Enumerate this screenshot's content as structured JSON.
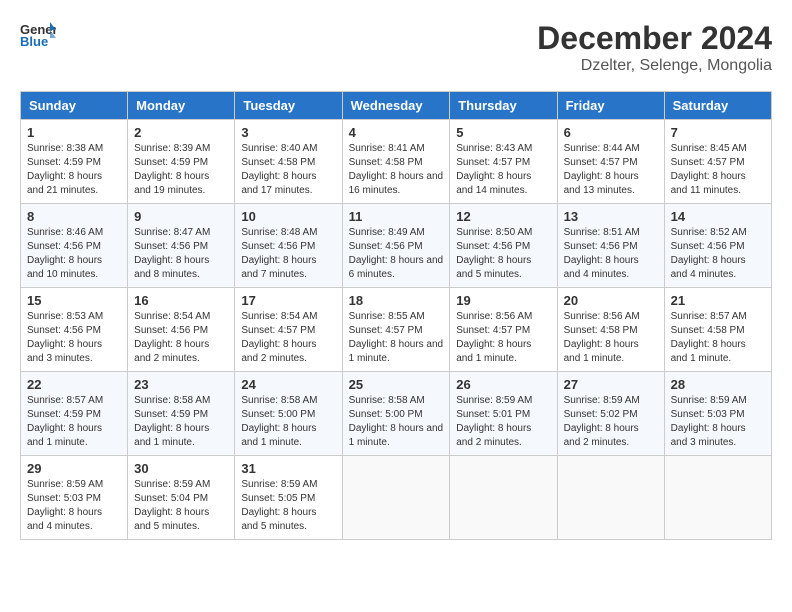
{
  "header": {
    "logo_line1": "General",
    "logo_line2": "Blue",
    "month_title": "December 2024",
    "subtitle": "Dzelter, Selenge, Mongolia"
  },
  "days_of_week": [
    "Sunday",
    "Monday",
    "Tuesday",
    "Wednesday",
    "Thursday",
    "Friday",
    "Saturday"
  ],
  "weeks": [
    [
      {
        "day": "1",
        "sunrise": "8:38 AM",
        "sunset": "4:59 PM",
        "daylight": "8 hours and 21 minutes."
      },
      {
        "day": "2",
        "sunrise": "8:39 AM",
        "sunset": "4:59 PM",
        "daylight": "8 hours and 19 minutes."
      },
      {
        "day": "3",
        "sunrise": "8:40 AM",
        "sunset": "4:58 PM",
        "daylight": "8 hours and 17 minutes."
      },
      {
        "day": "4",
        "sunrise": "8:41 AM",
        "sunset": "4:58 PM",
        "daylight": "8 hours and 16 minutes."
      },
      {
        "day": "5",
        "sunrise": "8:43 AM",
        "sunset": "4:57 PM",
        "daylight": "8 hours and 14 minutes."
      },
      {
        "day": "6",
        "sunrise": "8:44 AM",
        "sunset": "4:57 PM",
        "daylight": "8 hours and 13 minutes."
      },
      {
        "day": "7",
        "sunrise": "8:45 AM",
        "sunset": "4:57 PM",
        "daylight": "8 hours and 11 minutes."
      }
    ],
    [
      {
        "day": "8",
        "sunrise": "8:46 AM",
        "sunset": "4:56 PM",
        "daylight": "8 hours and 10 minutes."
      },
      {
        "day": "9",
        "sunrise": "8:47 AM",
        "sunset": "4:56 PM",
        "daylight": "8 hours and 8 minutes."
      },
      {
        "day": "10",
        "sunrise": "8:48 AM",
        "sunset": "4:56 PM",
        "daylight": "8 hours and 7 minutes."
      },
      {
        "day": "11",
        "sunrise": "8:49 AM",
        "sunset": "4:56 PM",
        "daylight": "8 hours and 6 minutes."
      },
      {
        "day": "12",
        "sunrise": "8:50 AM",
        "sunset": "4:56 PM",
        "daylight": "8 hours and 5 minutes."
      },
      {
        "day": "13",
        "sunrise": "8:51 AM",
        "sunset": "4:56 PM",
        "daylight": "8 hours and 4 minutes."
      },
      {
        "day": "14",
        "sunrise": "8:52 AM",
        "sunset": "4:56 PM",
        "daylight": "8 hours and 4 minutes."
      }
    ],
    [
      {
        "day": "15",
        "sunrise": "8:53 AM",
        "sunset": "4:56 PM",
        "daylight": "8 hours and 3 minutes."
      },
      {
        "day": "16",
        "sunrise": "8:54 AM",
        "sunset": "4:56 PM",
        "daylight": "8 hours and 2 minutes."
      },
      {
        "day": "17",
        "sunrise": "8:54 AM",
        "sunset": "4:57 PM",
        "daylight": "8 hours and 2 minutes."
      },
      {
        "day": "18",
        "sunrise": "8:55 AM",
        "sunset": "4:57 PM",
        "daylight": "8 hours and 1 minute."
      },
      {
        "day": "19",
        "sunrise": "8:56 AM",
        "sunset": "4:57 PM",
        "daylight": "8 hours and 1 minute."
      },
      {
        "day": "20",
        "sunrise": "8:56 AM",
        "sunset": "4:58 PM",
        "daylight": "8 hours and 1 minute."
      },
      {
        "day": "21",
        "sunrise": "8:57 AM",
        "sunset": "4:58 PM",
        "daylight": "8 hours and 1 minute."
      }
    ],
    [
      {
        "day": "22",
        "sunrise": "8:57 AM",
        "sunset": "4:59 PM",
        "daylight": "8 hours and 1 minute."
      },
      {
        "day": "23",
        "sunrise": "8:58 AM",
        "sunset": "4:59 PM",
        "daylight": "8 hours and 1 minute."
      },
      {
        "day": "24",
        "sunrise": "8:58 AM",
        "sunset": "5:00 PM",
        "daylight": "8 hours and 1 minute."
      },
      {
        "day": "25",
        "sunrise": "8:58 AM",
        "sunset": "5:00 PM",
        "daylight": "8 hours and 1 minute."
      },
      {
        "day": "26",
        "sunrise": "8:59 AM",
        "sunset": "5:01 PM",
        "daylight": "8 hours and 2 minutes."
      },
      {
        "day": "27",
        "sunrise": "8:59 AM",
        "sunset": "5:02 PM",
        "daylight": "8 hours and 2 minutes."
      },
      {
        "day": "28",
        "sunrise": "8:59 AM",
        "sunset": "5:03 PM",
        "daylight": "8 hours and 3 minutes."
      }
    ],
    [
      {
        "day": "29",
        "sunrise": "8:59 AM",
        "sunset": "5:03 PM",
        "daylight": "8 hours and 4 minutes."
      },
      {
        "day": "30",
        "sunrise": "8:59 AM",
        "sunset": "5:04 PM",
        "daylight": "8 hours and 5 minutes."
      },
      {
        "day": "31",
        "sunrise": "8:59 AM",
        "sunset": "5:05 PM",
        "daylight": "8 hours and 5 minutes."
      },
      null,
      null,
      null,
      null
    ]
  ],
  "labels": {
    "sunrise": "Sunrise:",
    "sunset": "Sunset:",
    "daylight": "Daylight:"
  }
}
